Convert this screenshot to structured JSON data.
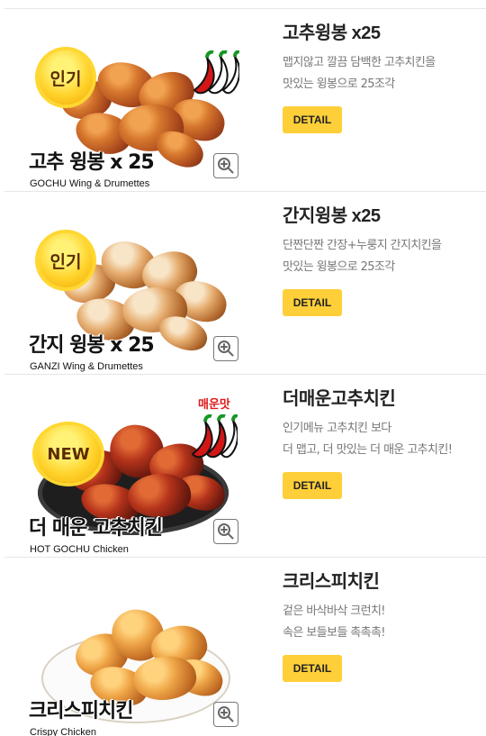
{
  "menu_items": [
    {
      "title": "고추윙봉 x25",
      "description_line1": "맵지않고 깔끔 담백한 고추치킨을",
      "description_line2": "맛있는 윙봉으로 25조각",
      "button_label": "DETAIL",
      "image_badge": "인기",
      "image_title": "고추 윙봉 x 25",
      "image_subtitle": "GOCHU Wing & Drumettes",
      "image_style": "red-pepper-chicken",
      "icon": "zoom-in-icon"
    },
    {
      "title": "간지윙봉 x25",
      "description_line1": "단짠단짠 간장+누룽지 간지치킨을",
      "description_line2": "맛있는 윙봉으로 25조각",
      "button_label": "DETAIL",
      "image_badge": "인기",
      "image_title": "간지 윙봉 x 25",
      "image_subtitle": "GANZI Wing & Drumettes",
      "image_style": "garlic-soy-chicken",
      "icon": "zoom-in-icon"
    },
    {
      "title": "더매운고추치킨",
      "description_line1": "인기메뉴 고추치킨 보다",
      "description_line2": "더 맵고, 더 맛있는 더 매운 고추치킨!",
      "button_label": "DETAIL",
      "image_badge": "NEW",
      "image_spicy_label": "매운맛",
      "image_title": "더 매운 고추치킨",
      "image_subtitle": "HOT GOCHU Chicken",
      "image_style": "hot-pepper-chicken",
      "icon": "zoom-in-icon"
    },
    {
      "title": "크리스피치킨",
      "description_line1": "겉은 바삭바삭 크런치!",
      "description_line2": "속은 보들보들 촉촉촉!",
      "button_label": "DETAIL",
      "image_title": "크리스피치킨",
      "image_subtitle": "Crispy Chicken",
      "image_style": "crispy-chicken",
      "icon": "zoom-in-icon"
    }
  ],
  "colors": {
    "button": "#ffcf39",
    "description_text": "#777777",
    "divider": "#e6e6e6",
    "spicy_label": "#e01919"
  }
}
